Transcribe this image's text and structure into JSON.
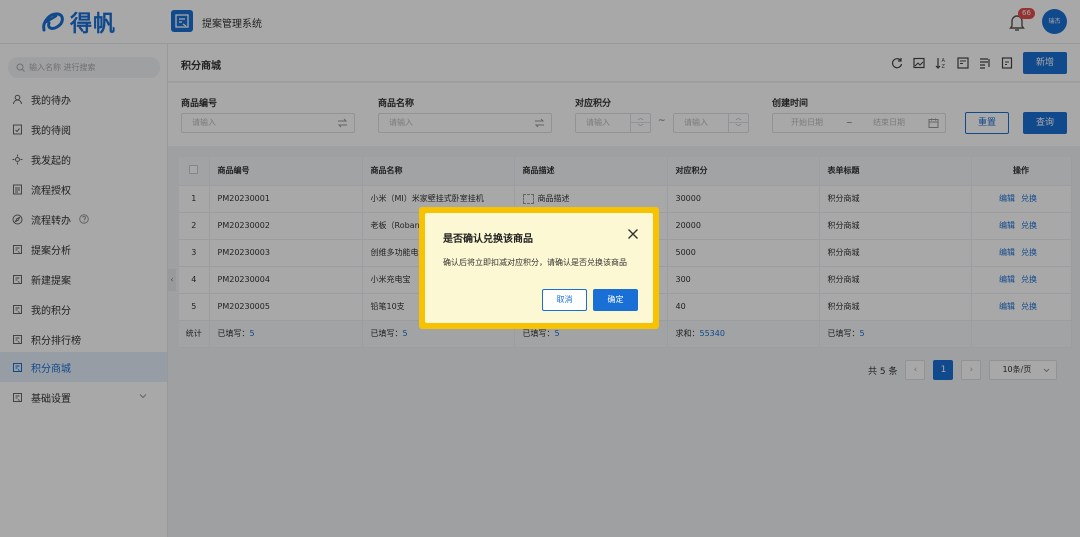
{
  "header": {
    "logo_text": "得帆",
    "app_title": "提案管理系统",
    "notification_count": "66",
    "avatar_text": "瑞杰"
  },
  "sidebar": {
    "search_placeholder": "输入名称 进行搜索",
    "items": [
      {
        "label": "我的待办",
        "icon": "user-icon"
      },
      {
        "label": "我的待阅",
        "icon": "doc-check-icon"
      },
      {
        "label": "我发起的",
        "icon": "spark-icon"
      },
      {
        "label": "流程授权",
        "icon": "doc-icon"
      },
      {
        "label": "流程转办",
        "icon": "compass-icon"
      },
      {
        "label": "提案分析",
        "icon": "form-icon"
      },
      {
        "label": "新建提案",
        "icon": "form-icon"
      },
      {
        "label": "我的积分",
        "icon": "form-icon"
      },
      {
        "label": "积分排行榜",
        "icon": "form-icon"
      },
      {
        "label": "积分商城",
        "icon": "form-icon",
        "active": true
      },
      {
        "label": "基础设置",
        "icon": "form-icon"
      }
    ]
  },
  "toolbar": {
    "page_title": "积分商城",
    "new_label": "新增"
  },
  "filters": {
    "code_label": "商品编号",
    "code_placeholder": "请输入",
    "name_label": "商品名称",
    "name_placeholder": "请输入",
    "points_label": "对应积分",
    "points_min_placeholder": "请输入",
    "points_max_placeholder": "请输入",
    "range_sep": "~",
    "created_label": "创建时间",
    "start_placeholder": "开始日期",
    "end_placeholder": "结束日期",
    "reset_label": "重置",
    "query_label": "查询"
  },
  "table": {
    "headers": [
      "商品编号",
      "商品名称",
      "商品描述",
      "对应积分",
      "表单标题",
      "操作"
    ],
    "rows": [
      {
        "index": "1",
        "code": "PM20230001",
        "name": "小米（MI）米家壁挂式卧室挂机",
        "desc": "商品描述",
        "points": "30000",
        "form": "积分商城"
      },
      {
        "index": "2",
        "code": "PM20230002",
        "name": "老板（Roban",
        "desc": "",
        "points": "20000",
        "form": "积分商城"
      },
      {
        "index": "3",
        "code": "PM20230003",
        "name": "创维多功能电",
        "desc": "",
        "points": "5000",
        "form": "积分商城"
      },
      {
        "index": "4",
        "code": "PM20230004",
        "name": "小米充电宝",
        "desc": "",
        "points": "300",
        "form": "积分商城"
      },
      {
        "index": "5",
        "code": "PM20230005",
        "name": "铅笔10支",
        "desc": "",
        "points": "40",
        "form": "积分商城"
      }
    ],
    "op_edit": "编辑",
    "op_redeem": "兑换",
    "stats": {
      "label": "统计",
      "filled_prefix": "已填写：",
      "filled_count": "5",
      "sum_prefix": "求和：",
      "sum_value": "55340"
    }
  },
  "pagination": {
    "total_text": "共 5 条",
    "current_page": "1",
    "page_size": "10条/页"
  },
  "dialog": {
    "title": "是否确认兑换该商品",
    "body": "确认后将立即扣减对应积分，请确认是否兑换该商品",
    "cancel_label": "取消",
    "ok_label": "确定"
  },
  "colors": {
    "primary": "#1a6fd6",
    "highlight": "#f7c300",
    "badge": "#e34d4d"
  }
}
